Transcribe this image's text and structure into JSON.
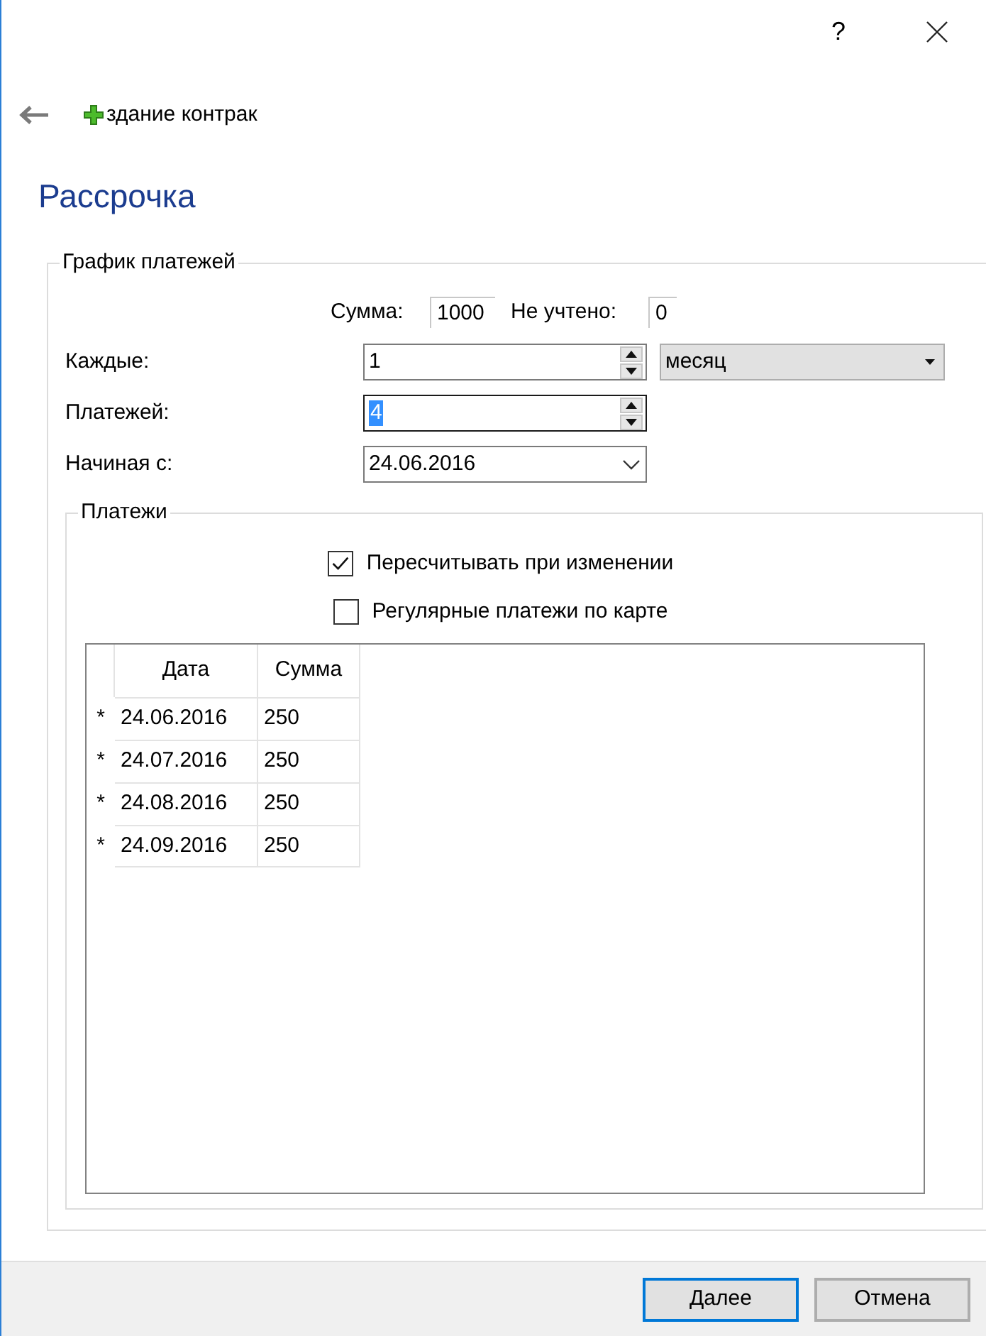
{
  "window": {
    "help": "?"
  },
  "header": {
    "title": "здание контрак"
  },
  "page_title": "Рассрочка",
  "schedule": {
    "legend": "График платежей",
    "sum_label": "Сумма:",
    "sum_value": "1000",
    "unaccounted_label": "Не учтено:",
    "unaccounted_value": "0",
    "fields": [
      {
        "kind": "spin",
        "label": "Каждые:",
        "value": "1",
        "focused": false,
        "unit": "месяц"
      },
      {
        "kind": "spin",
        "label": "Платежей:",
        "value": "4",
        "focused": true
      },
      {
        "kind": "date",
        "label": "Начиная с:",
        "value": "24.06.2016"
      }
    ]
  },
  "payments": {
    "legend": "Платежи",
    "options": [
      {
        "label": "Пересчитывать при изменении",
        "checked": true
      },
      {
        "label": "Регулярные платежи по карте",
        "checked": false
      }
    ],
    "table": {
      "columns": [
        "Дата",
        "Сумма"
      ],
      "rows": [
        {
          "marker": "*",
          "cells": [
            "24.06.2016",
            "250"
          ]
        },
        {
          "marker": "*",
          "cells": [
            "24.07.2016",
            "250"
          ]
        },
        {
          "marker": "*",
          "cells": [
            "24.08.2016",
            "250"
          ]
        },
        {
          "marker": "*",
          "cells": [
            "24.09.2016",
            "250"
          ]
        }
      ]
    }
  },
  "buttons": [
    {
      "label": "Далее",
      "default": true
    },
    {
      "label": "Отмена",
      "default": false
    }
  ]
}
